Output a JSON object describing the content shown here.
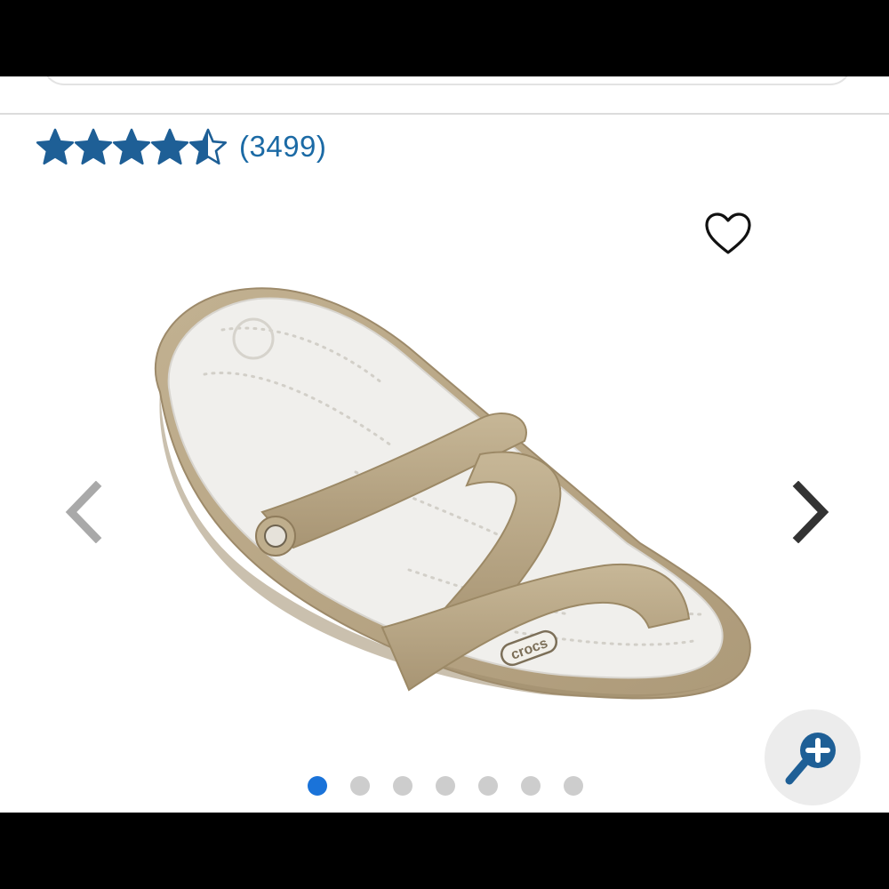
{
  "rating": {
    "value": 4.5,
    "max": 5,
    "review_count": "(3499)"
  },
  "icons": {
    "wishlist": "heart-icon",
    "prev": "chevron-left-icon",
    "next": "chevron-right-icon",
    "zoom": "zoom-in-icon"
  },
  "carousel": {
    "total_images": 7,
    "active_index": 0
  },
  "product": {
    "image_logo_text": "crocs"
  },
  "colors": {
    "star_blue": "#1e5f96",
    "link_blue": "#1b6aa5",
    "active_dot": "#1a73d9",
    "inactive_dot": "#cdcdcd",
    "strap_tan": "#b7a584",
    "footbed": "#f0efec"
  }
}
